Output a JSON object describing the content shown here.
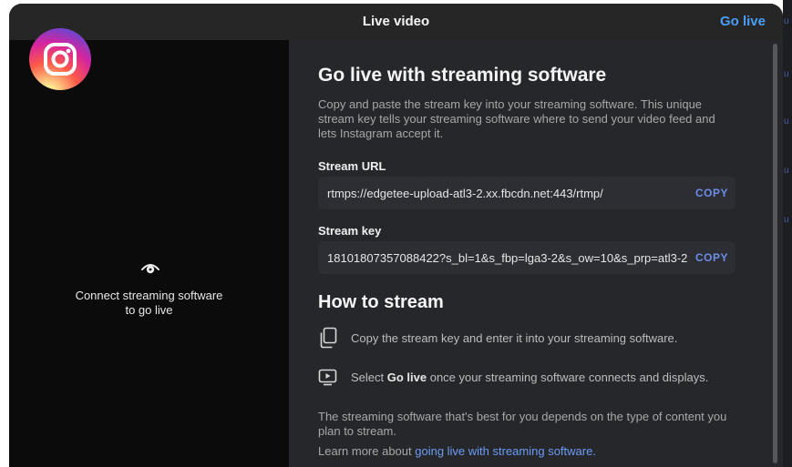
{
  "header": {
    "title": "Live video",
    "go_live_label": "Go live"
  },
  "preview": {
    "message_line1": "Connect streaming software",
    "message_line2": "to go live"
  },
  "main": {
    "title": "Go live with streaming software",
    "description": "Copy and paste the stream key into your streaming software. This unique stream key tells your streaming software where to send your video feed and lets Instagram accept it.",
    "stream_url": {
      "label": "Stream URL",
      "value": "rtmps://edgetee-upload-atl3-2.xx.fbcdn.net:443/rtmp/",
      "copy_label": "COPY"
    },
    "stream_key": {
      "label": "Stream key",
      "value": "18101807357088422?s_bl=1&s_fbp=lga3-2&s_ow=10&s_prp=atl3-2",
      "copy_label": "COPY"
    },
    "how_to": {
      "title": "How to stream",
      "step1": "Copy the stream key and enter it into your streaming software.",
      "step2_prefix": "Select ",
      "step2_bold": "Go live",
      "step2_suffix": " once your streaming software connects and displays."
    },
    "note": "The streaming software that's best for you depends on the type of content you plan to stream.",
    "learn_prefix": "Learn more about ",
    "learn_link": "going live with streaming software."
  },
  "colors": {
    "accent": "#4a9df8",
    "link": "#6d9cf5",
    "copy": "#6d8ee8",
    "panel": "#25272b"
  },
  "icons": {
    "logo": "instagram-logo",
    "preview": "eye-icon",
    "step1": "copy-document-icon",
    "step2": "play-screen-icon"
  }
}
